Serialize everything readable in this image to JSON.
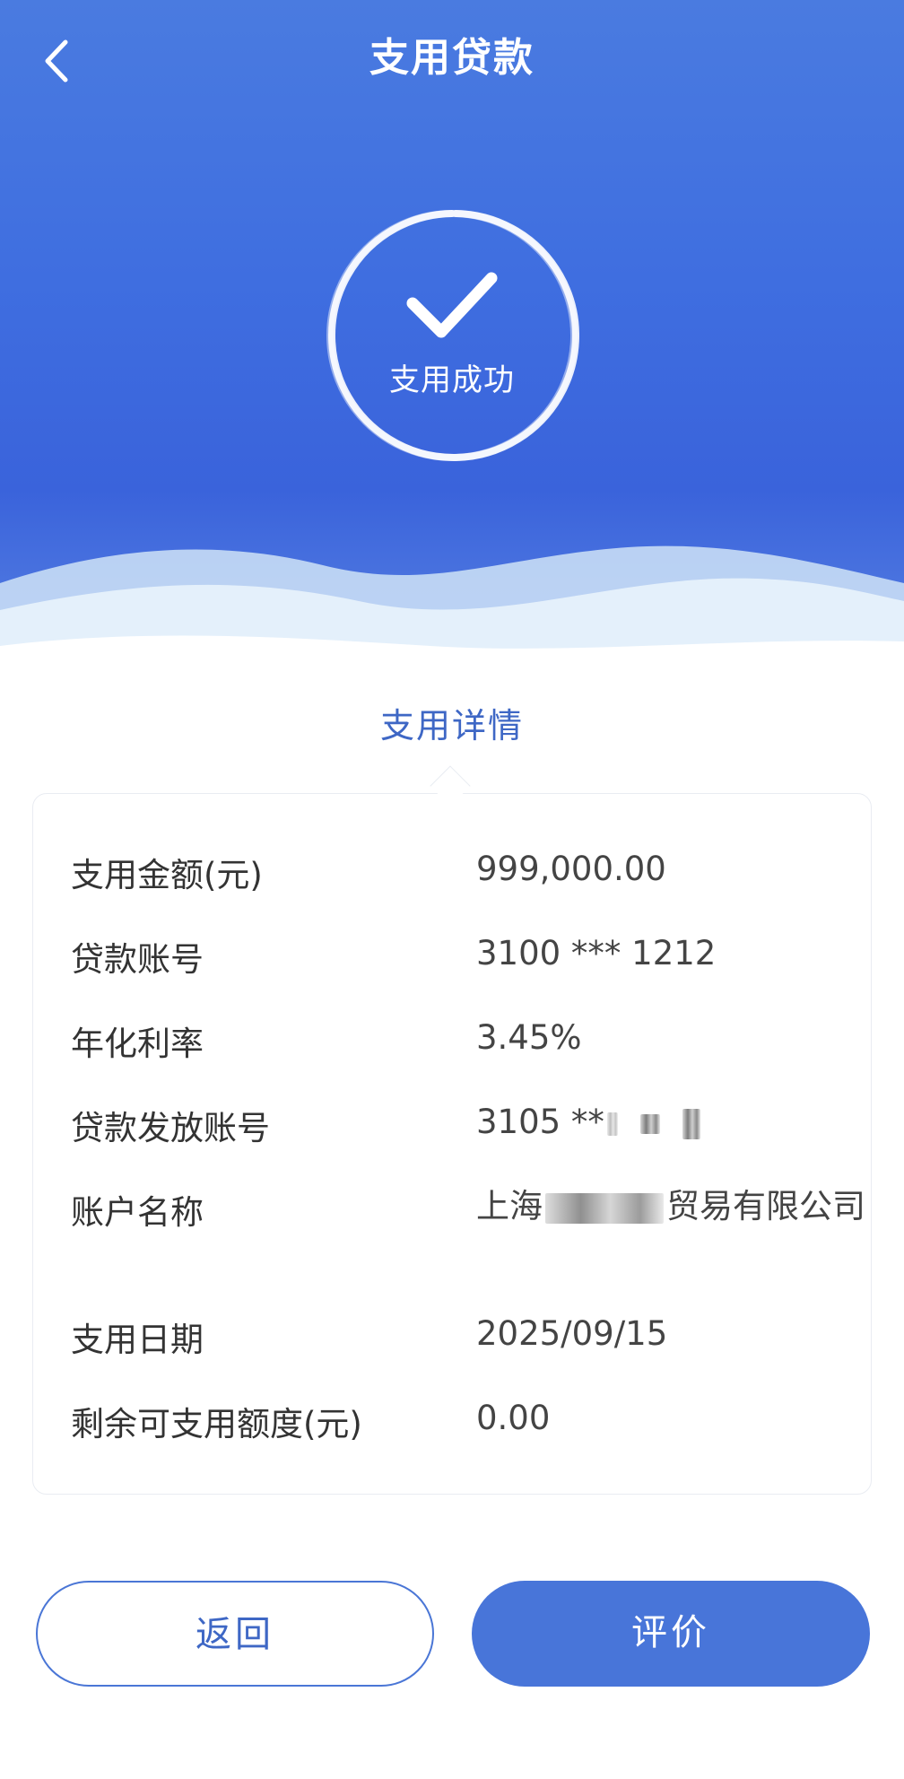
{
  "header": {
    "title": "支用贷款",
    "back_icon": "chevron-left-icon"
  },
  "status": {
    "text": "支用成功",
    "icon": "check-icon"
  },
  "details": {
    "section_title": "支用详情",
    "rows": [
      {
        "label": "支用金额(元)",
        "value": "999,000.00"
      },
      {
        "label": "贷款账号",
        "value": "3100 *** 1212"
      },
      {
        "label": "年化利率",
        "value": "3.45%"
      },
      {
        "label": "贷款发放账号",
        "value": "3105 **"
      },
      {
        "label": "账户名称",
        "value_prefix": "上海",
        "value_suffix": "贸易有限公司"
      },
      {
        "label": "支用日期",
        "value": "2025/09/15"
      },
      {
        "label": "剩余可支用额度(元)",
        "value": "0.00"
      }
    ]
  },
  "actions": {
    "back_label": "返回",
    "rate_label": "评价"
  },
  "colors": {
    "primary": "#4875d9",
    "header_gradient_top": "#4a7be0",
    "section_title": "#3e67c5"
  }
}
